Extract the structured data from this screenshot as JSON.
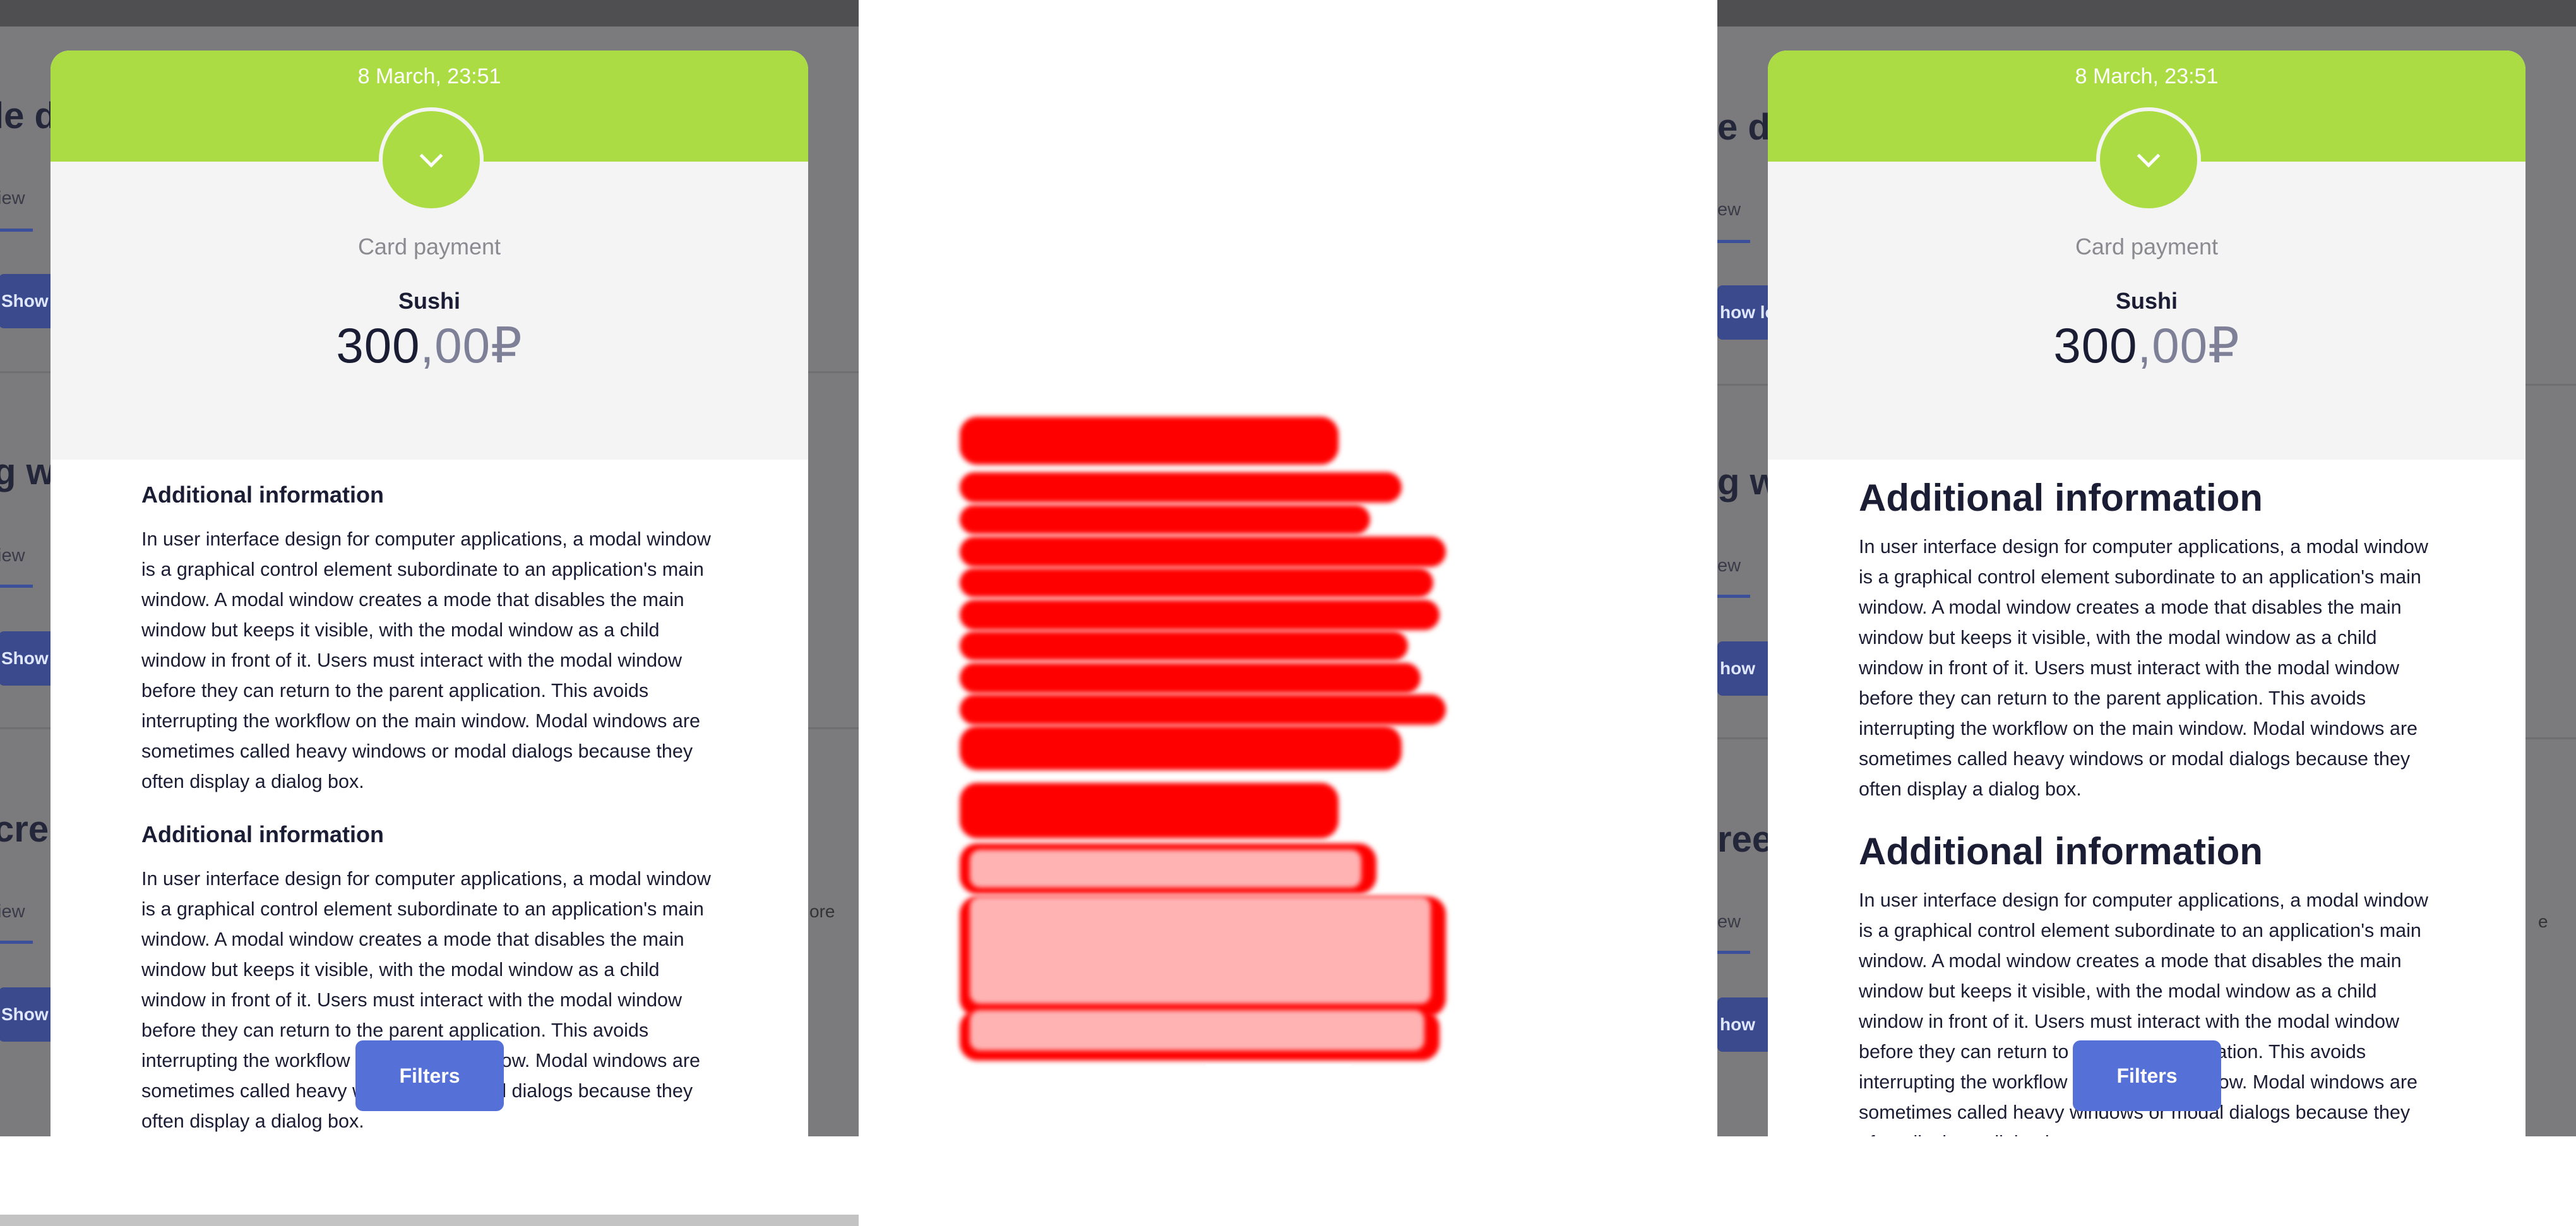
{
  "card": {
    "date": "8 March, 23:51",
    "payment_method": "Card payment",
    "merchant": "Sushi",
    "amount_int": "300",
    "amount_sep": ",",
    "amount_dec": "00",
    "currency": "₽",
    "sections": [
      {
        "heading": "Additional information",
        "body": "In user interface design for computer applications, a modal window is a graphical control element subordinate to an application's main window. A modal window creates a mode that disables the main window but keeps it visible, with the modal window as a child window in front of it. Users must interact with the modal window before they can return to the parent application. This avoids interrupting the workflow on the main window. Modal windows are sometimes called heavy windows or modal dialogs because they often display a dialog box."
      },
      {
        "heading": "Additional information",
        "body": "In user interface design for computer applications, a modal window is a graphical control element subordinate to an application's main window. A modal window creates a mode that disables the main window but keeps it visible, with the modal window as a child window in front of it. Users must interact with the modal window before they can return to the parent application. This avoids interrupting the workflow on the main window. Modal windows are sometimes called heavy windows or modal dialogs because they often display a dialog box."
      }
    ],
    "filters_label": "Filters"
  },
  "background": {
    "left": {
      "titles": [
        "le di",
        "g w",
        "cre"
      ],
      "tab": "iew",
      "button": "Show",
      "more": "ore"
    },
    "right": {
      "titles": [
        "e dia",
        "g wit",
        "reen"
      ],
      "tab": "ew",
      "buttons": [
        "how lo",
        "how",
        "how"
      ],
      "more": "e"
    }
  },
  "colors": {
    "header_green": "#abdc44",
    "grey_area": "#f4f4f4",
    "text_dark": "#1a1d33",
    "accent_blue": "#5570d6",
    "overlay_dim": "#7b7b7d",
    "redaction": "#ff0000"
  }
}
